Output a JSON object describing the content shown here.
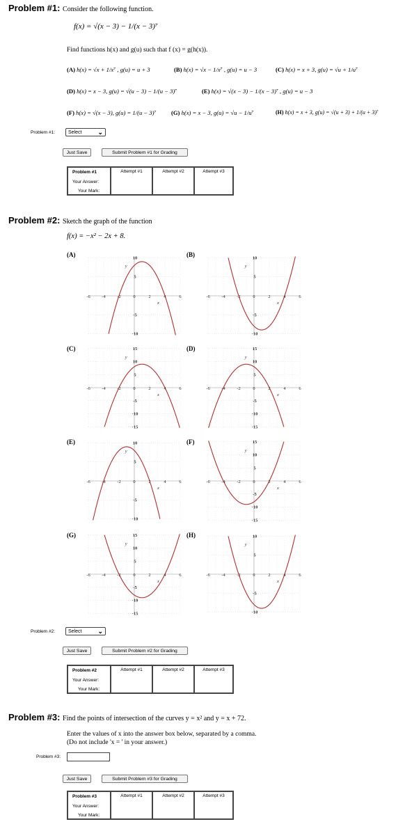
{
  "problem1": {
    "heading": "Problem #1:",
    "desc": "Consider the following function.",
    "function": "f(x) = √(x − 3) − 1/(x − 3)⁷",
    "instruction": "Find functions h(x) and g(u) such that f (x) = g(h(x)).",
    "choices": [
      {
        "letter": "(A)",
        "text": "h(x) = √x + 1/x⁷ , g(u) = u + 3"
      },
      {
        "letter": "(B)",
        "text": "h(x) = √x − 1/x⁷ , g(u) = u − 3"
      },
      {
        "letter": "(C)",
        "text": "h(x) = x + 3, g(u) = √u + 1/u⁷"
      },
      {
        "letter": "(D)",
        "text": "h(x) = x − 3, g(u) = √(u − 3) − 1/(u − 3)⁷"
      },
      {
        "letter": "(E)",
        "text": "h(x) = √(x − 3) − 1/(x − 3)⁷ , g(u) = u − 3"
      },
      {
        "letter": "(F)",
        "text": "h(x) = √(x − 3), g(u) = 1/(u − 3)⁷"
      },
      {
        "letter": "(G)",
        "text": "h(x) = x − 3, g(u) = √u − 1/u⁷"
      },
      {
        "letter": "(H)",
        "text": "h(x) = x + 3, g(u) = √(u + 3) + 1/(u + 3)⁷"
      }
    ],
    "select_label": "Problem #1:",
    "select_value": "Select",
    "save": "Just Save",
    "submit": "Submit Problem #1 for Grading",
    "table": {
      "title": "Problem #1",
      "answer": "Your Answer:",
      "mark": "Your Mark:",
      "attempts": [
        "Attempt #1",
        "Attempt #2",
        "Attempt #3"
      ]
    }
  },
  "problem2": {
    "heading": "Problem #2:",
    "desc": "Sketch the graph of the function",
    "function": "f(x) = −x² − 2x + 8.",
    "graph_letters": [
      "(A)",
      "(B)",
      "(C)",
      "(D)",
      "(E)",
      "(F)",
      "(G)",
      "(H)"
    ],
    "axis": {
      "x_ticks": [
        "-6",
        "-4",
        "-2",
        "0",
        "2",
        "4",
        "6"
      ],
      "x_name": "x",
      "y_name": "y"
    },
    "select_label": "Problem #2:",
    "select_value": "Select",
    "save": "Just Save",
    "submit": "Submit Problem #2 for Grading",
    "table": {
      "title": "Problem #2",
      "answer": "Your Answer:",
      "mark": "Your Mark:",
      "attempts": [
        "Attempt #1",
        "Attempt #2",
        "Attempt #3"
      ]
    }
  },
  "problem3": {
    "heading": "Problem #3:",
    "desc": "Find the points of intersection of the curves  y = x²  and  y = x + 72.",
    "instruction1": "Enter the values of x into the answer box below, separated by a comma.",
    "instruction2": "(Do not include 'x = ' in your answer.)",
    "input_label": "Problem #3:",
    "input_value": "",
    "save": "Just Save",
    "submit": "Submit Problem #3 for Grading",
    "table": {
      "title": "Problem #3",
      "answer": "Your Answer:",
      "mark": "Your Mark:",
      "attempts": [
        "Attempt #1",
        "Attempt #2",
        "Attempt #3"
      ]
    }
  },
  "chart_data": [
    {
      "type": "line",
      "label": "(A)",
      "formula": "y = -x^2 + 2x + 8",
      "x": [
        -6,
        6
      ],
      "ylim": [
        -10,
        10
      ],
      "y_ticks": [
        "10",
        "5",
        "-5",
        "-10"
      ]
    },
    {
      "type": "line",
      "label": "(B)",
      "formula": "y = x^2 - 2x - 8",
      "x": [
        -6,
        6
      ],
      "ylim": [
        -10,
        10
      ],
      "y_ticks": [
        "10",
        "5",
        "-5",
        "-10"
      ]
    },
    {
      "type": "line",
      "label": "(C)",
      "formula": "y = -x^2 + 2x + 8",
      "x": [
        -6,
        6
      ],
      "ylim": [
        -15,
        15
      ],
      "y_ticks": [
        "15",
        "10",
        "5",
        "-5",
        "-10",
        "-15"
      ]
    },
    {
      "type": "line",
      "label": "(D)",
      "formula": "y = -x^2 - 2x + 8",
      "x": [
        -6,
        6
      ],
      "ylim": [
        -15,
        15
      ],
      "y_ticks": [
        "15",
        "10",
        "5",
        "-5",
        "-10",
        "-15"
      ]
    },
    {
      "type": "line",
      "label": "(E)",
      "formula": "y = -x^2 - 2x + 8",
      "x": [
        -6,
        6
      ],
      "ylim": [
        -10,
        10
      ],
      "y_ticks": [
        "10",
        "5",
        "-5",
        "-10"
      ]
    },
    {
      "type": "line",
      "label": "(F)",
      "formula": "y = x^2 + 2x - 8",
      "x": [
        -6,
        6
      ],
      "ylim": [
        -15,
        15
      ],
      "y_ticks": [
        "15",
        "10",
        "5",
        "-5",
        "-10",
        "-15"
      ]
    },
    {
      "type": "line",
      "label": "(G)",
      "formula": "y = x^2 - 2x - 8",
      "x": [
        -6,
        6
      ],
      "ylim": [
        -15,
        15
      ],
      "y_ticks": [
        "15",
        "10",
        "5",
        "-5",
        "-10",
        "-15"
      ]
    },
    {
      "type": "line",
      "label": "(H)",
      "formula": "y = x^2 - 2x - 8",
      "x": [
        -6,
        6
      ],
      "ylim": [
        -10,
        10
      ],
      "y_ticks": [
        "10",
        "5",
        "-5",
        "-10"
      ]
    }
  ],
  "colors": {
    "curve": "#b03030",
    "grid": "#d0d0d0",
    "axis": "#999999"
  }
}
